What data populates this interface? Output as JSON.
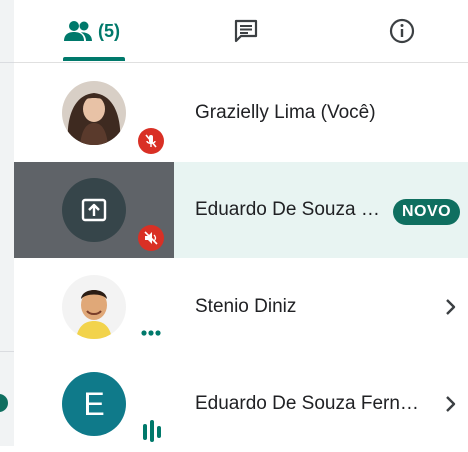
{
  "tabs": {
    "people_count": "(5)",
    "active": "people"
  },
  "participants": [
    {
      "name": "Grazielly Lima (Você)",
      "mic": "muted"
    },
    {
      "name": "Eduardo De Souza …",
      "badge": "NOVO",
      "audio": "muted",
      "presenting": true
    },
    {
      "name": "Stenio Diniz",
      "status": "more-options"
    },
    {
      "name": "Eduardo De Souza Fern…",
      "avatar_letter": "E",
      "status": "speaking"
    }
  ],
  "colors": {
    "accent": "#00796b",
    "badge_bg": "#0f6f60",
    "highlight_row": "#e8f4f2",
    "presenting_tile": "#5f6368",
    "mute_red": "#d93025"
  }
}
